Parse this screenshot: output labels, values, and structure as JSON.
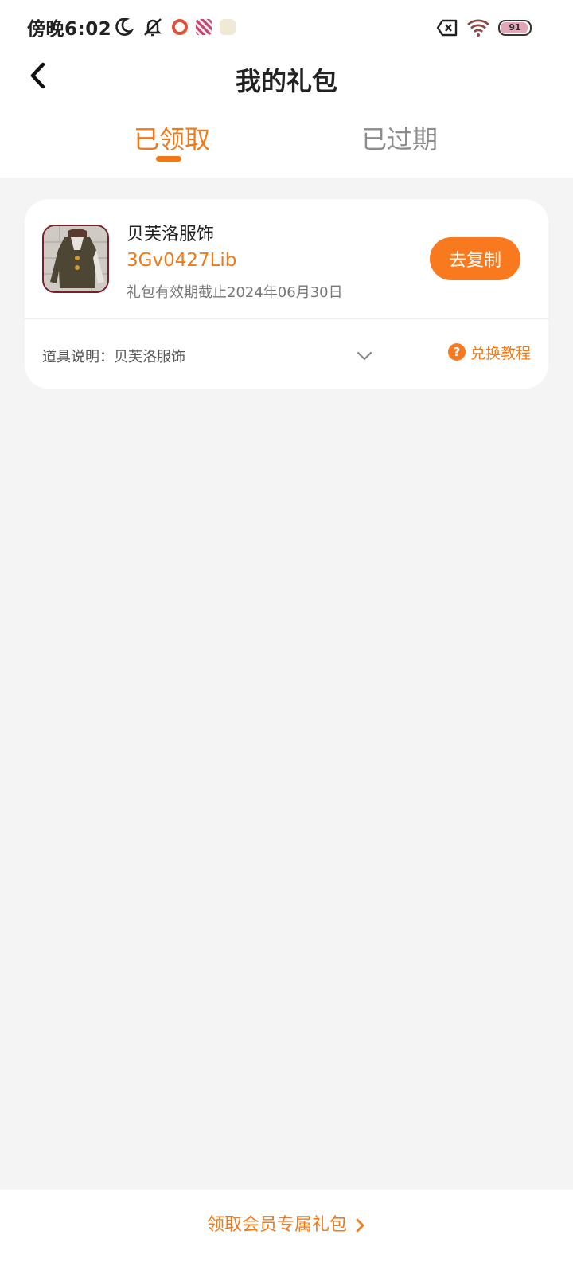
{
  "status_bar": {
    "time": "傍晚6:02",
    "battery": "91"
  },
  "header": {
    "title": "我的礼包"
  },
  "tabs": [
    {
      "label": "已领取",
      "active": true
    },
    {
      "label": "已过期",
      "active": false
    }
  ],
  "gift": {
    "name": "贝芙洛服饰",
    "code": "3Gv0427Lib",
    "expiry": "礼包有效期截止2024年06月30日",
    "copy_button": "去复制",
    "description_label": "道具说明：",
    "description_value": "贝芙洛服饰",
    "guide_label": "兑换教程"
  },
  "footer": {
    "vip_link": "领取会员专属礼包"
  },
  "colors": {
    "accent": "#f07a1a",
    "button": "#f97a1e",
    "background": "#f4f4f4"
  }
}
